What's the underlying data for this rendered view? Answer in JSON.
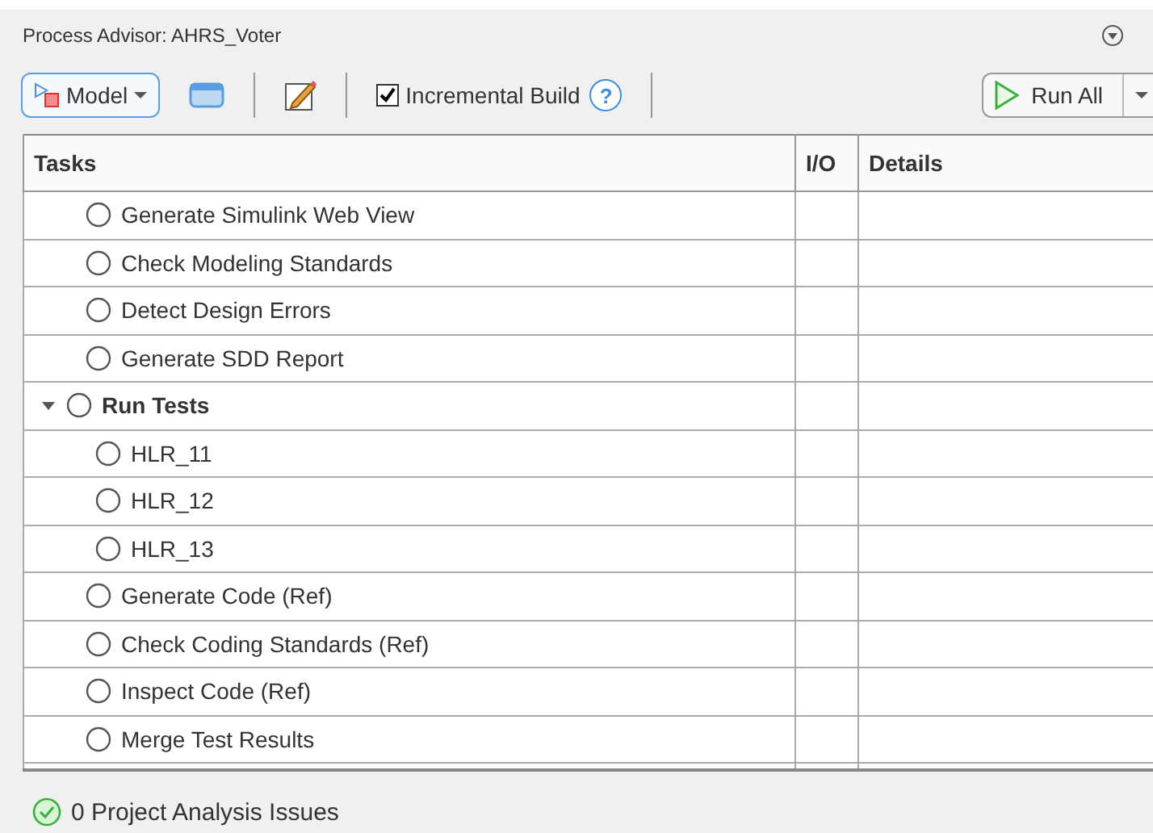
{
  "window": {
    "title": "Process Advisor: AHRS_Voter"
  },
  "toolbar": {
    "model_button": "Model",
    "incremental_build": {
      "label": "Incremental Build",
      "checked": true
    },
    "help": "?",
    "run_all": "Run All"
  },
  "table": {
    "columns": [
      "Tasks",
      "I/O",
      "Details"
    ],
    "rows": [
      {
        "task": "Generate Simulink Web View"
      },
      {
        "task": "Check Modeling Standards"
      },
      {
        "task": "Detect Design Errors"
      },
      {
        "task": "Generate SDD Report"
      },
      {
        "task": "Run Tests",
        "expanded": true,
        "children": [
          {
            "task": "HLR_11"
          },
          {
            "task": "HLR_12"
          },
          {
            "task": "HLR_13"
          }
        ]
      },
      {
        "task": "Generate Code (Ref)"
      },
      {
        "task": "Check Coding Standards (Ref)"
      },
      {
        "task": "Inspect Code (Ref)"
      },
      {
        "task": "Merge Test Results"
      }
    ]
  },
  "status_bar": {
    "text": "0 Project Analysis Issues"
  }
}
